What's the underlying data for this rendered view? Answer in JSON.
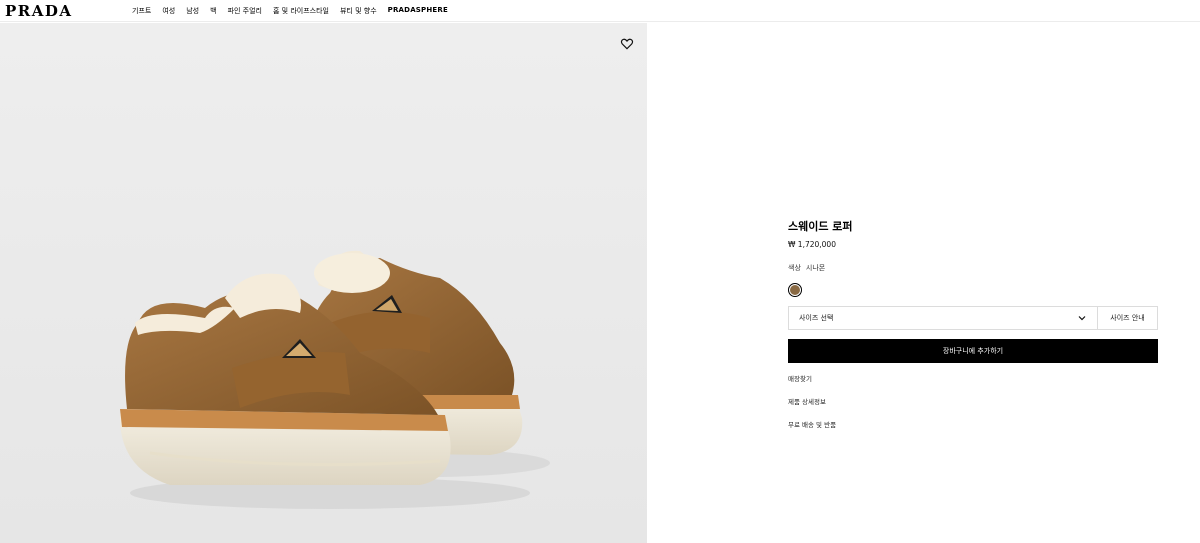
{
  "header": {
    "logo": "PRADA",
    "nav": [
      "기프트",
      "여성",
      "남성",
      "백",
      "파인 주얼리",
      "홈 및 라이프스타일",
      "뷰티 및 향수",
      "PRADASPHERE"
    ]
  },
  "gallery": {
    "background": "#efefef",
    "wishlist_icon": "heart-icon"
  },
  "product": {
    "title": "스웨이드 로퍼",
    "price": "₩ 1,720,000",
    "color_label": "색상",
    "color_value": "시나몬",
    "swatch_color": "#8a6a44",
    "size_select": "사이즈 선택",
    "size_guide": "사이즈 안내",
    "add_to_cart": "장바구니에 추가하기",
    "links": [
      "매장찾기",
      "제품 상세정보",
      "무료 배송 및 반품"
    ]
  }
}
